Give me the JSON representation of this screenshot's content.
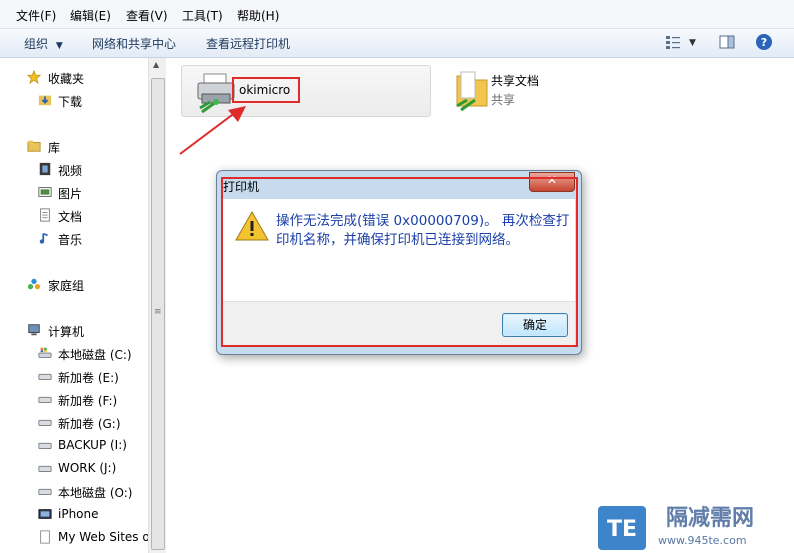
{
  "menu": [
    "文件(F)",
    "编辑(E)",
    "查看(V)",
    "工具(T)",
    "帮助(H)"
  ],
  "toolbar": {
    "organize": "组织",
    "network_center": "网络和共享中心",
    "view_printers": "查看远程打印机"
  },
  "sidebar": {
    "favorites": "收藏夹",
    "downloads": "下载",
    "libraries": "库",
    "videos": "视频",
    "pictures": "图片",
    "documents": "文档",
    "music": "音乐",
    "homegroup": "家庭组",
    "computer": "计算机",
    "drives": [
      "本地磁盘 (C:)",
      "新加卷 (E:)",
      "新加卷 (F:)",
      "新加卷 (G:)",
      "BACKUP (I:)",
      "WORK (J:)",
      "本地磁盘 (O:)",
      "iPhone",
      "My Web Sites o"
    ]
  },
  "content": {
    "printer_name": "okimicro",
    "share_name": "共享文档",
    "share_sub": "共享"
  },
  "dialog": {
    "title": "打印机",
    "message": "操作无法完成(错误 0x00000709)。 再次检查打印机名称，并确保打印机已连接到网络。",
    "ok": "确定"
  },
  "watermark": {
    "title": "隔减需网",
    "url": "www.945te.com"
  },
  "colors": {
    "annotation_red": "#e02b2b",
    "link_blue": "#1a3fa8"
  }
}
